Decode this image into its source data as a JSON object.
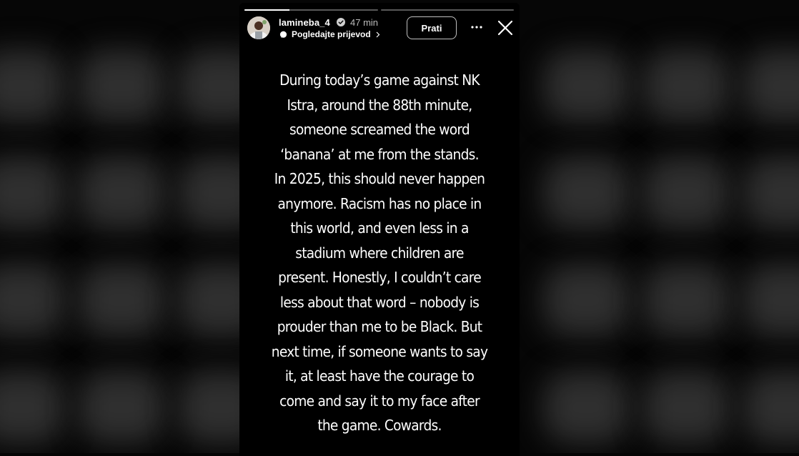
{
  "story": {
    "progress_segments": [
      {
        "fill": 0.34
      },
      {
        "fill": 0.0
      }
    ],
    "header": {
      "username": "lamineba_4",
      "time": "47 min",
      "translate_label": "Pogledajte prijevod",
      "follow_label": "Prati",
      "icons": [
        "verified-icon",
        "translate-icon",
        "chevron-right-icon",
        "more-icon",
        "close-icon"
      ]
    },
    "text_lines": [
      "During today’s game against NK",
      "Istra, around the 88th minute,",
      "someone screamed the word",
      "‘banana’ at me from the stands.",
      "In 2025, this should never happen",
      "anymore. Racism has no place in",
      "this world, and even less in a",
      "stadium where children are",
      "present. Honestly, I couldn’t care",
      "less about that word – nobody is",
      "prouder than me to be Black. But",
      "next time, if someone wants to say",
      "it, at least have the courage to",
      "come and say it to my face after",
      "the game. Cowards."
    ]
  },
  "colors": {
    "background": "#060606",
    "story_background": "#000000",
    "text": "#ffffff",
    "verified": "#3897f0"
  }
}
